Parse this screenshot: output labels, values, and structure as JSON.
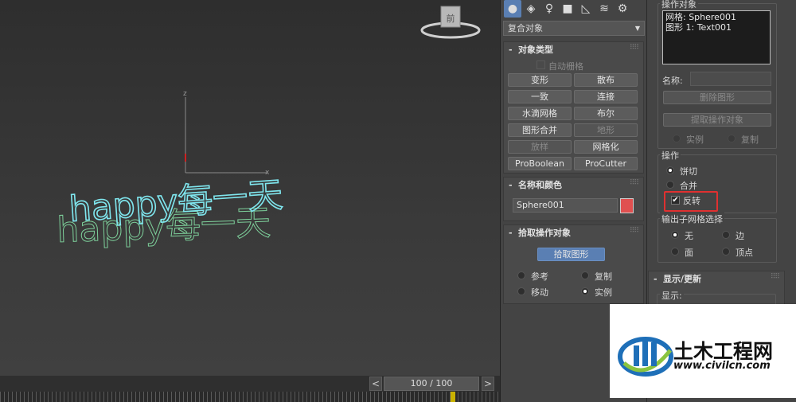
{
  "viewport": {
    "axis_z": "z",
    "axis_x": "x",
    "text_front": "happy每一天",
    "text_back": "happy每一天",
    "viewcube_label": "前"
  },
  "timeline": {
    "frame": "100 / 100",
    "prev": "<",
    "next": ">"
  },
  "command_panel": {
    "category": "复合对象",
    "object_type": {
      "title": "对象类型",
      "autogrid_label": "自动栅格",
      "buttons": [
        "变形",
        "散布",
        "一致",
        "连接",
        "水滴网格",
        "布尔",
        "图形合并",
        "地形",
        "放样",
        "网格化",
        "ProBoolean",
        "ProCutter"
      ]
    },
    "name_color": {
      "title": "名称和颜色",
      "name": "Sphere001",
      "color": "#e05050"
    },
    "pick_operand": {
      "title": "拾取操作对象",
      "pick_button": "拾取图形",
      "options": [
        "参考",
        "复制",
        "移动",
        "实例"
      ]
    }
  },
  "right_panel": {
    "operands_title": "操作对象",
    "operands": [
      "网格: Sphere001",
      "图形 1: Text001"
    ],
    "name_label": "名称:",
    "delete_shape": "删除图形",
    "extract_operand": "提取操作对象",
    "extract_opts": [
      "实例",
      "复制"
    ],
    "operation_title": "操作",
    "operation_opts": [
      "饼切",
      "合并"
    ],
    "invert_label": "反转",
    "output_title": "输出子网格选择",
    "output_opts": [
      "无",
      "边",
      "面",
      "顶点"
    ],
    "display_title": "显示/更新",
    "display_label": "显示:"
  },
  "watermark": {
    "title": "土木工程网",
    "url": "www.civilcn.com"
  }
}
